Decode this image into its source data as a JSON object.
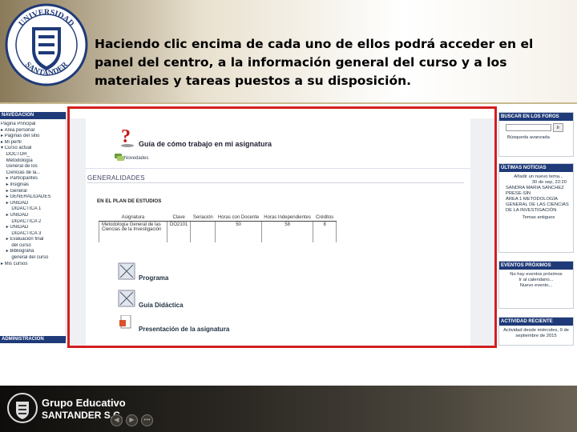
{
  "caption": "Haciendo clic encima de cada uno de ellos podrá acceder en el panel del centro, a la información general del curso y a los materiales y tareas puestos a su disposición.",
  "seal": {
    "text_top": "UNIVERSIDAD",
    "text_bottom": "SANTANDER"
  },
  "footer": {
    "line1": "Grupo Educativo",
    "line2": "SANTANDER S.C."
  },
  "left_nav": {
    "header": "NAVEGACIÓN",
    "items": [
      "Página Principal",
      "▸ Área personal",
      "▸ Páginas del sitio",
      "▸ Mi perfil",
      "▾ Curso actual",
      "  DOCTOR_",
      "  Metodología",
      "  General de los",
      "  Ciencias de la...",
      "  ▸ Participantes",
      "  ▸ Insignias",
      "  ▸ General",
      "  ▸ GENERALIDADES",
      "  ▸ UNIDAD",
      "    DIDÁCTICA 1",
      "  ▸ UNIDAD",
      "    DIDÁCTICA 2",
      "  ▸ UNIDAD",
      "    DIDÁCTICA 3",
      "  ▸ Evaluación final",
      "    del curso",
      "  ▸ Bibliografía",
      "    general del curso",
      "▸ Mis cursos"
    ],
    "admin_header": "ADMINISTRACIÓN"
  },
  "course": {
    "guide_title": "Guía de cómo trabajo en mi asignatura",
    "news": "Novedades",
    "section": "GENERALIDADES",
    "plan": "EN EL PLAN DE ESTUDIOS",
    "table_headers": [
      "Asignatura",
      "Clave",
      "Seriación",
      "Horas con Docente",
      "Horas Independientes",
      "Créditos"
    ],
    "table_rows": [
      [
        "Metodología General de las Ciencias de la Investigación",
        "DO2101",
        "",
        "50",
        "58",
        "8"
      ]
    ],
    "resources": [
      "Programa",
      "Guía Didáctica",
      "Presentación de la asignatura"
    ]
  },
  "right": {
    "search": {
      "header": "BUSCAR EN LOS FOROS",
      "button": "Ir",
      "link": "Búsqueda avanzada"
    },
    "news": {
      "header": "ÚLTIMAS NOTICIAS",
      "add": "Añadir un nuevo tema...",
      "date": "30 de sep, 22:20",
      "author": "SANDRA MARIA SANCHEZ",
      "body": "PRESE-SÍN",
      "subject": "ÁREA 1 METODOLOGÍA GENERAL DE LAS CIENCIAS DE LA INVESTIGACIÓN",
      "older": "Temas antiguos"
    },
    "events": {
      "header": "EVENTOS PRÓXIMOS",
      "text": "No hay eventos próximos",
      "link1": "Ir al calendario...",
      "link2": "Nuevo evento..."
    },
    "activity": {
      "header": "ACTIVIDAD RECIENTE",
      "text": "Actividad desde miércoles, 9 de septiembre de 2015"
    }
  },
  "colors": {
    "frame": "#d21f1f",
    "header": "#1e3a78"
  }
}
